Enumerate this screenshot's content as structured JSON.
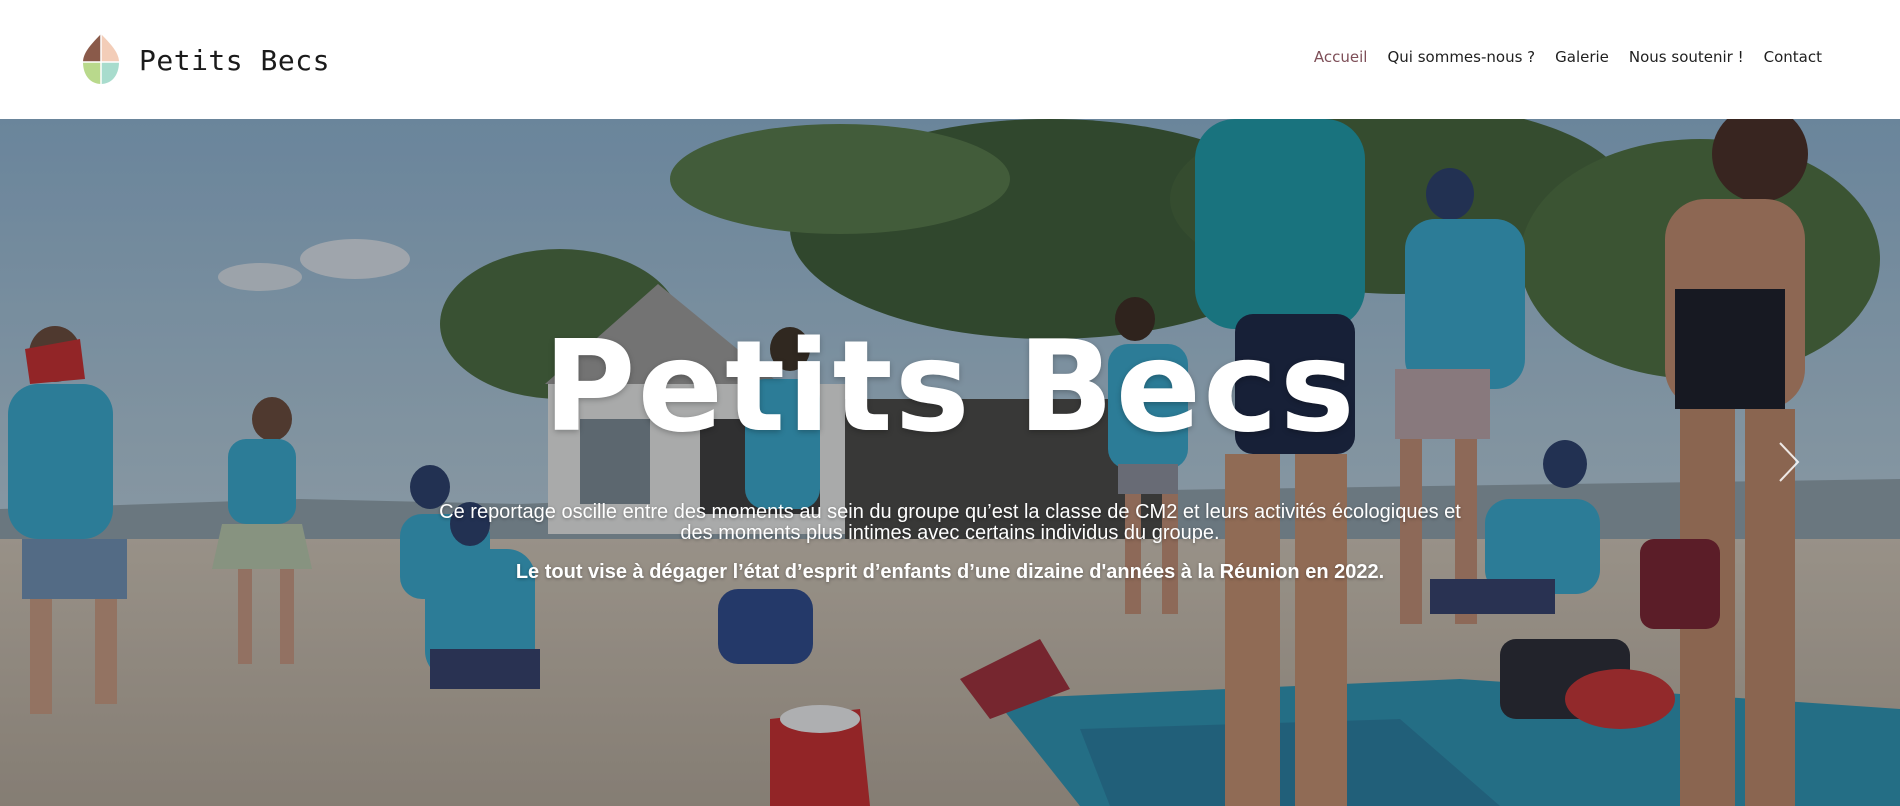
{
  "header": {
    "brand": "Petits Becs",
    "logo_icon": "leaf-drop-logo-icon",
    "nav": [
      {
        "label": "Accueil",
        "active": true
      },
      {
        "label": "Qui sommes-nous ?",
        "active": false
      },
      {
        "label": "Galerie",
        "active": false
      },
      {
        "label": "Nous soutenir !",
        "active": false
      },
      {
        "label": "Contact",
        "active": false
      }
    ]
  },
  "hero": {
    "title": "Petits Becs",
    "paragraph": "Ce reportage oscille entre des moments au sein du groupe qu’est la classe de CM2 et leurs activités écologiques et des moments plus intimes avec certains individus du groupe.",
    "highlight": "Le tout vise à dégager l’état d’esprit d’enfants d’une dizaine d'années à la Réunion en 2022.",
    "next_icon": "chevron-right-icon"
  },
  "colors": {
    "active_nav": "#7e4f58",
    "logo_brown": "#8a5a4a",
    "logo_peach": "#f3cdb8",
    "logo_green": "#b9d98c",
    "logo_mint": "#a8dccd",
    "shirt_blue": "#3aa7c9"
  }
}
